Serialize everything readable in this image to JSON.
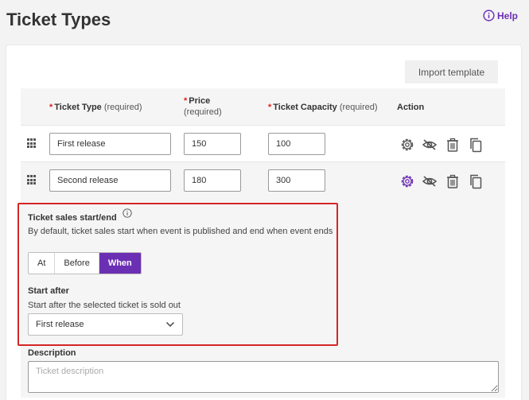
{
  "page": {
    "title": "Ticket Types",
    "help_label": "Help"
  },
  "toolbar": {
    "import_label": "Import template"
  },
  "table": {
    "columns": {
      "ticket_type": {
        "star": "*",
        "label": "Ticket Type",
        "note": "(required)"
      },
      "price": {
        "star": "*",
        "label": "Price",
        "note": "(required)"
      },
      "capacity": {
        "star": "*",
        "label": "Ticket Capacity",
        "note": "(required)"
      },
      "action": {
        "label": "Action"
      }
    },
    "rows": [
      {
        "name": "First release",
        "price": "150",
        "capacity": "100"
      },
      {
        "name": "Second release",
        "price": "180",
        "capacity": "300"
      }
    ]
  },
  "detail": {
    "sales_label": "Ticket sales start/end",
    "sales_help": "By default, ticket sales start when event is published and end when event ends",
    "modes": [
      "At",
      "Before",
      "When"
    ],
    "active_mode": "When",
    "start_after_label": "Start after",
    "start_after_help": "Start after the selected ticket is sold out",
    "start_after_value": "First release",
    "description_label": "Description",
    "description_placeholder": "Ticket description"
  },
  "colors": {
    "accent": "#6b2fb3",
    "required_star": "#e02020",
    "highlight_border": "#d52626"
  }
}
